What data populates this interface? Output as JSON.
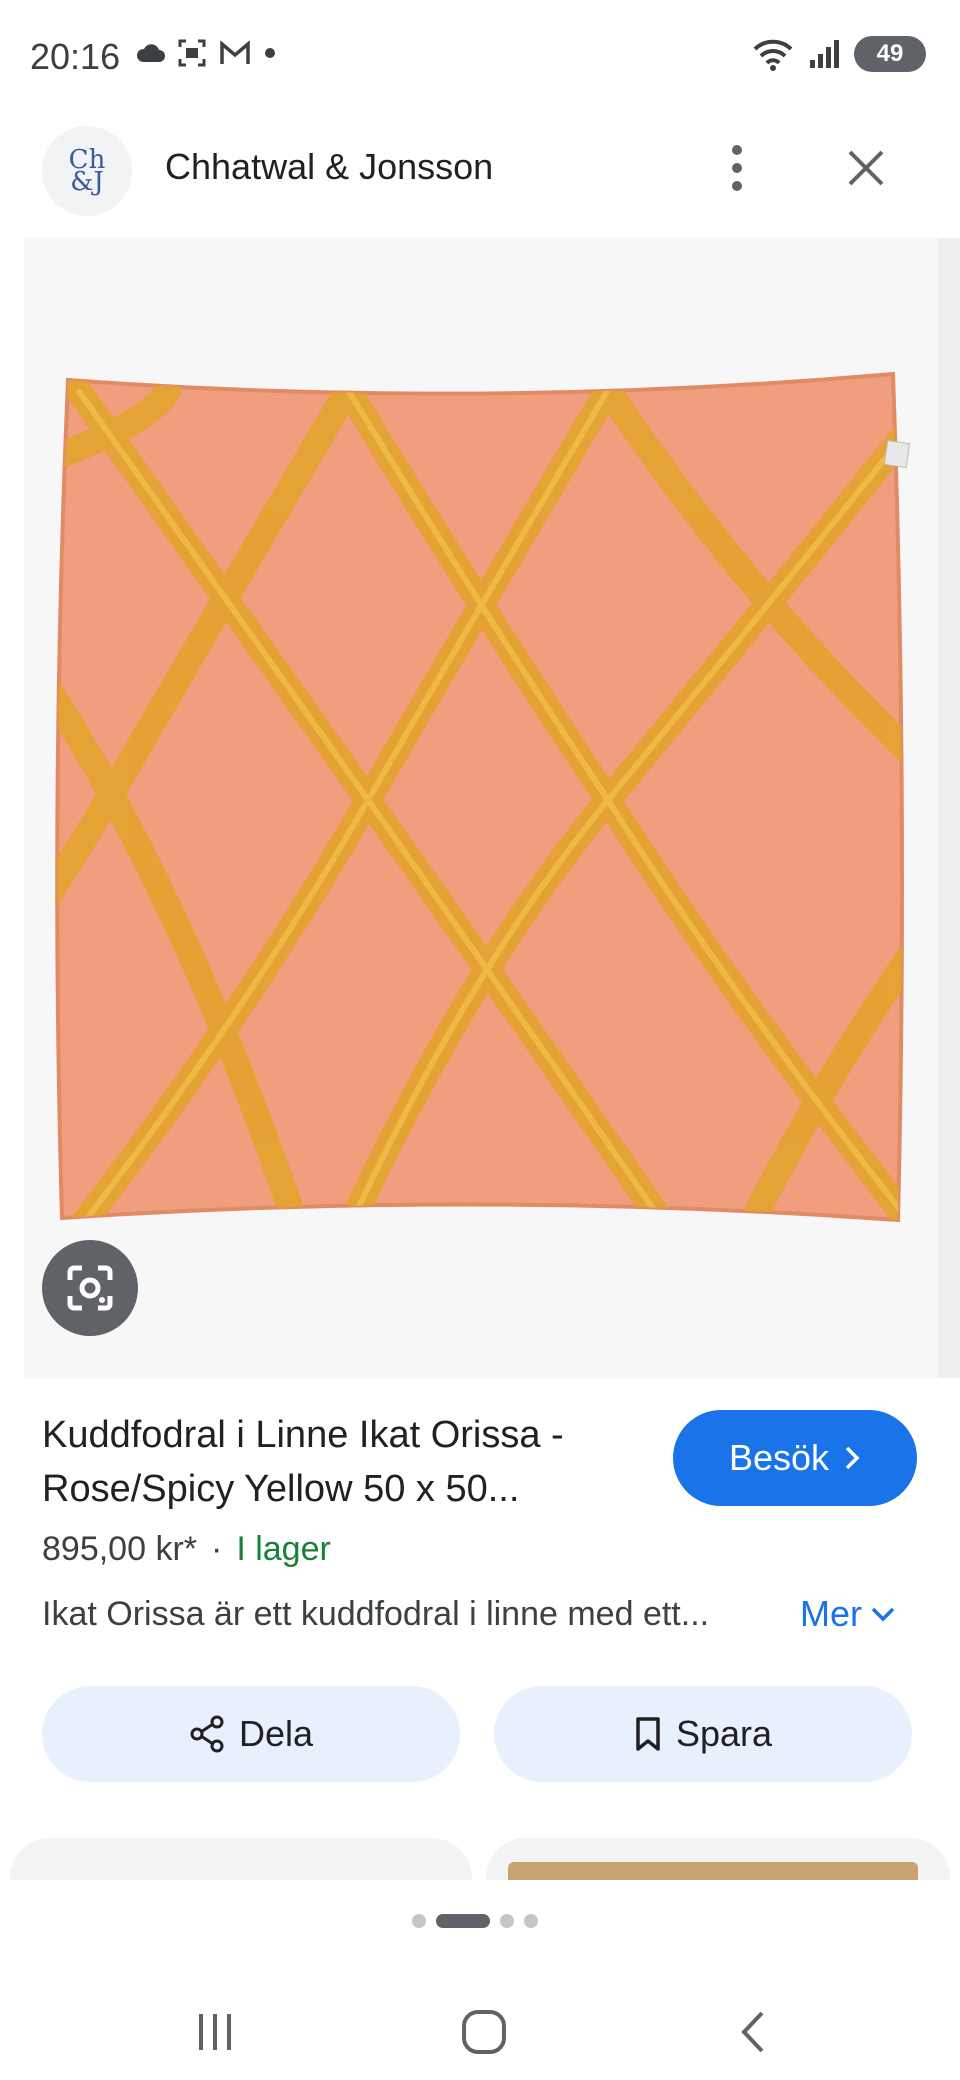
{
  "status_bar": {
    "time": "20:16",
    "battery": "49",
    "icons": [
      "cloud-icon",
      "screenshot-icon",
      "gmail-icon",
      "dot-icon",
      "wifi-icon",
      "signal-icon"
    ]
  },
  "header": {
    "logo_text": "Ch&J",
    "site_name": "Chhatwal & Jonsson"
  },
  "product": {
    "title": "Kuddfodral i Linne Ikat Orissa - Rose/Spicy Yellow 50 x 50...",
    "price": "895,00 kr*",
    "separator": "·",
    "stock": "I lager",
    "description": "Ikat Orissa är ett kuddfodral i linne med ett...",
    "more_label": "Mer",
    "visit_label": "Besök"
  },
  "actions": {
    "share_label": "Dela",
    "save_label": "Spara"
  },
  "colors": {
    "accent": "#1a73e8",
    "stock_green": "#188038",
    "chip_bg": "#e8f0fe",
    "pillow_rose": "#f0a07e",
    "pillow_yellow": "#e0a530"
  },
  "pager": {
    "total": 4,
    "active": 1
  }
}
